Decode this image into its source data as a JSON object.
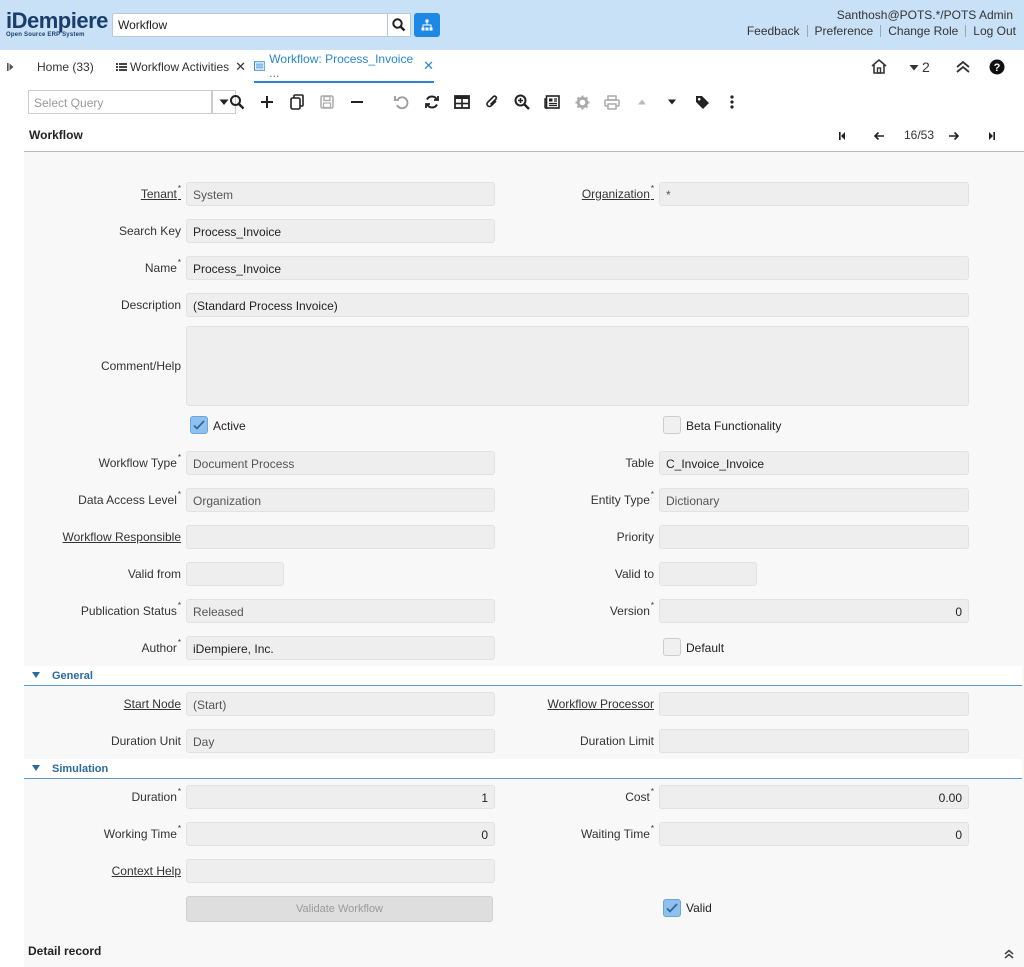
{
  "header": {
    "logo_text": "iDempiere",
    "logo_sub": "Open Source ERP System",
    "search_value": "Workflow",
    "user": "Santhosh@POTS.*/POTS Admin",
    "links": [
      "Feedback",
      "Preference",
      "Change Role",
      "Log Out"
    ]
  },
  "tabs": [
    {
      "label": "Home (33)"
    },
    {
      "label": "Workflow Activities"
    },
    {
      "label": "Workflow: Process_Invoice ..."
    }
  ],
  "right_tools": {
    "count": "2"
  },
  "toolbar": {
    "query_placeholder": "Select Query"
  },
  "window": {
    "title": "Workflow",
    "record_position": "16/53"
  },
  "fields": {
    "tenant": {
      "label": "Tenant",
      "value": "System"
    },
    "organization": {
      "label": "Organization",
      "value": "*"
    },
    "search_key": {
      "label": "Search Key",
      "value": "Process_Invoice"
    },
    "name": {
      "label": "Name",
      "value": "Process_Invoice"
    },
    "description": {
      "label": "Description",
      "value": "(Standard Process Invoice)"
    },
    "comment_help": {
      "label": "Comment/Help",
      "value": ""
    },
    "active": {
      "label": "Active",
      "checked": true
    },
    "beta": {
      "label": "Beta Functionality",
      "checked": false
    },
    "workflow_type": {
      "label": "Workflow Type",
      "value": "Document Process"
    },
    "table": {
      "label": "Table",
      "value": "C_Invoice_Invoice"
    },
    "data_access_level": {
      "label": "Data Access Level",
      "value": "Organization"
    },
    "entity_type": {
      "label": "Entity Type",
      "value": "Dictionary"
    },
    "workflow_responsible": {
      "label": "Workflow Responsible",
      "value": ""
    },
    "priority": {
      "label": "Priority",
      "value": ""
    },
    "valid_from": {
      "label": "Valid from",
      "value": ""
    },
    "valid_to": {
      "label": "Valid to",
      "value": ""
    },
    "publication_status": {
      "label": "Publication Status",
      "value": "Released"
    },
    "version": {
      "label": "Version",
      "value": "0"
    },
    "author": {
      "label": "Author",
      "value": "iDempiere, Inc."
    },
    "default": {
      "label": "Default",
      "checked": false
    },
    "start_node": {
      "label": "Start Node",
      "value": "(Start)"
    },
    "workflow_processor": {
      "label": "Workflow Processor",
      "value": ""
    },
    "duration_unit": {
      "label": "Duration Unit",
      "value": "Day"
    },
    "duration_limit": {
      "label": "Duration Limit",
      "value": ""
    },
    "duration": {
      "label": "Duration",
      "value": "1"
    },
    "cost": {
      "label": "Cost",
      "value": "0.00"
    },
    "working_time": {
      "label": "Working Time",
      "value": "0"
    },
    "waiting_time": {
      "label": "Waiting Time",
      "value": "0"
    },
    "context_help": {
      "label": "Context Help",
      "value": ""
    },
    "valid": {
      "label": "Valid",
      "checked": true
    }
  },
  "sections": {
    "general": "General",
    "simulation": "Simulation"
  },
  "buttons": {
    "validate_workflow": "Validate Workflow"
  },
  "detail": {
    "title": "Detail record"
  },
  "colors": {
    "header_bg": "#c8e1f7",
    "accent": "#2a86d0",
    "tree_button": "#1e88e5"
  }
}
